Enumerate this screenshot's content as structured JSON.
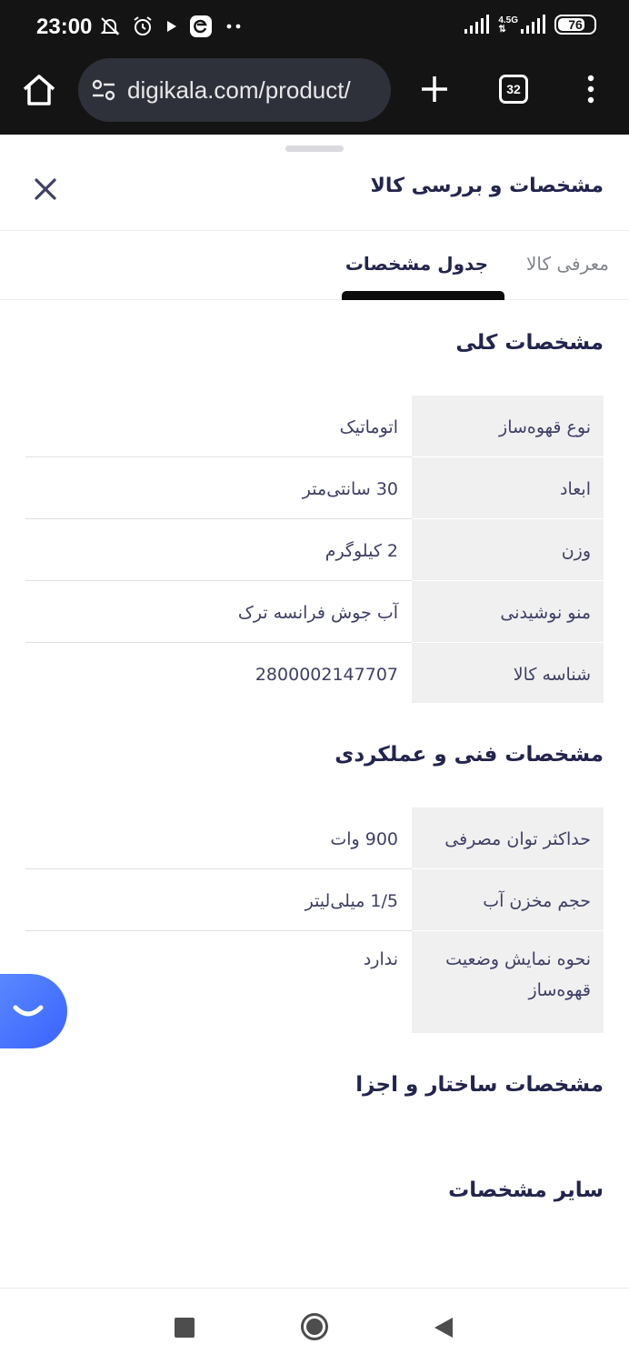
{
  "status_bar": {
    "time": "23:00",
    "network_type": "4.5G",
    "battery_level": "76",
    "battery_fraction": 0.76,
    "icons": [
      "mute-bell-icon",
      "alarm-icon",
      "play-icon",
      "app-e-icon",
      "more-dots-icon",
      "signal-icon",
      "signal-icon-2"
    ]
  },
  "browser": {
    "url": "digikala.com/product/",
    "tab_count": "32",
    "icons": [
      "home-icon",
      "site-settings-icon",
      "new-tab-plus-icon",
      "tabs-counter-icon",
      "overflow-menu-icon"
    ]
  },
  "sheet": {
    "title": "مشخصات و بررسی کالا",
    "tabs": [
      {
        "label": "معرفی کالا",
        "active": false
      },
      {
        "label": "جدول مشخصات",
        "active": true
      }
    ]
  },
  "sections": [
    {
      "title": "مشخصات کلی",
      "rows": [
        {
          "key": "نوع قهوه‌ساز",
          "value": "اتوماتیک"
        },
        {
          "key": "ابعاد",
          "value": "30 سانتی‌متر"
        },
        {
          "key": "وزن",
          "value": "2 کیلوگرم"
        },
        {
          "key": "منو نوشیدنی",
          "value": "آب جوش فرانسه ترک"
        },
        {
          "key": "شناسه کالا",
          "value": "2800002147707"
        }
      ]
    },
    {
      "title": "مشخصات فنی و عملکردی",
      "rows": [
        {
          "key": "حداکثر توان مصرفی",
          "value": "900 وات"
        },
        {
          "key": "حجم مخزن آب",
          "value": "1/5 میلی‌لیتر"
        },
        {
          "key": "نحوه نمایش وضعیت قهوه‌ساز",
          "value": "ندارد"
        }
      ]
    },
    {
      "title": "مشخصات ساختار و اجزا",
      "rows": []
    },
    {
      "title": "سایر مشخصات",
      "rows": []
    }
  ],
  "colors": {
    "accent_blue": "#3a63ff",
    "text_primary": "#23254e",
    "text_secondary": "#81858b",
    "key_cell_bg": "#f0f0f1"
  }
}
